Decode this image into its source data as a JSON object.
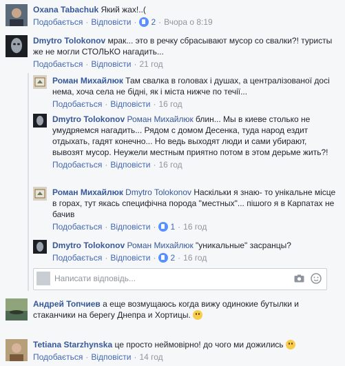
{
  "actions": {
    "like": "Подобається",
    "reply": "Відповісти",
    "sep": "·"
  },
  "comments": [
    {
      "name": "Oxana Tabachuk",
      "text": "Який жах!..(",
      "reactions": "2",
      "time": "Вчора о 8:19"
    },
    {
      "name": "Dmytro Tolokonov",
      "text": "мрак... это в речку сбрасывают мусор со свалки?! туристы же не могли СТОЛЬКО нагадить...",
      "time": "21 год"
    },
    {
      "name": "Андрей Топчиев",
      "text": "а еще возмущаюсь когда вижу одинокие бутылки и стаканчики на берегу Днепра и Хортицы.",
      "time": ""
    },
    {
      "name": "Tetiana Starzhynska",
      "text": "це просто неймовірно! до чого ми дожились",
      "time": "14 год"
    }
  ],
  "replies": [
    {
      "name": "Роман Михайлюк",
      "mention": "",
      "text": "Там свалка в головах і душах, а централізованої досі нема, хоча села не бідні, як і міста нижче по течії...",
      "time": "16 год"
    },
    {
      "name": "Dmytro Tolokonov",
      "mention": "Роман Михайлюк",
      "text": "блин... Мы в киеве столько не умудряемся нагадить... Рядом с домом Десенка, туда народ ездит отдыхать, гадят конечно... Но ведь выходят люди и сами убирают, вывозят мусор. Неужели местным приятно потом в этом дерьме жить?!",
      "time": "16 год"
    },
    {
      "name": "Роман Михайлюк",
      "mention": "Dmytro Tolokonov",
      "text": "Наскільки я знаю- то унікальне місце в горах, тут якась специфічна порода \"местных\"... пішого я в Карпатах не бачив",
      "reactions": "1",
      "time": "16 год"
    },
    {
      "name": "Dmytro Tolokonov",
      "mention": "Роман Михайлюк",
      "text": "\"уникальные\" засранцы?",
      "reactions": "2",
      "time": "16 год"
    }
  ],
  "reply_input": {
    "placeholder": "Написати відповідь..."
  },
  "icons": {
    "camera": "camera-icon",
    "emoji": "emoji-icon",
    "reaction": "like-icon"
  },
  "colors": {
    "link": "#4267b2",
    "name": "#365899",
    "muted": "#90949c",
    "bg": "#f6f7f9"
  }
}
